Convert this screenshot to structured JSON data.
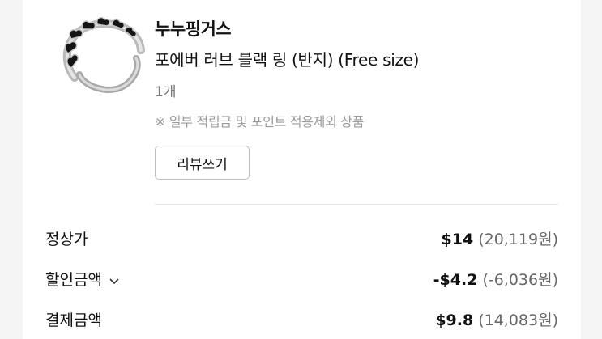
{
  "product": {
    "seller": "누누핑거스",
    "name": "포에버 러브 블랙 링 (반지) (Free size)",
    "quantity": "1개",
    "notice": "※ 일부 적립금 및 포인트 적용제외 상품",
    "review_button": "리뷰쓰기",
    "image_icon": "heart-ring-image"
  },
  "summary": {
    "rows": [
      {
        "label": "정상가",
        "amount": "$14",
        "krw": "(20,119원)"
      },
      {
        "label": "할인금액",
        "amount": "-$4.2",
        "krw": "(-6,036원)",
        "icon": "chevron-down-icon"
      },
      {
        "label": "결제금액",
        "amount": "$9.8",
        "krw": "(14,083원)"
      }
    ]
  },
  "colors": {
    "background": "#f5f5f5",
    "card": "#ffffff",
    "muted_text": "#9a9a9a",
    "border": "#bdbdbd"
  }
}
